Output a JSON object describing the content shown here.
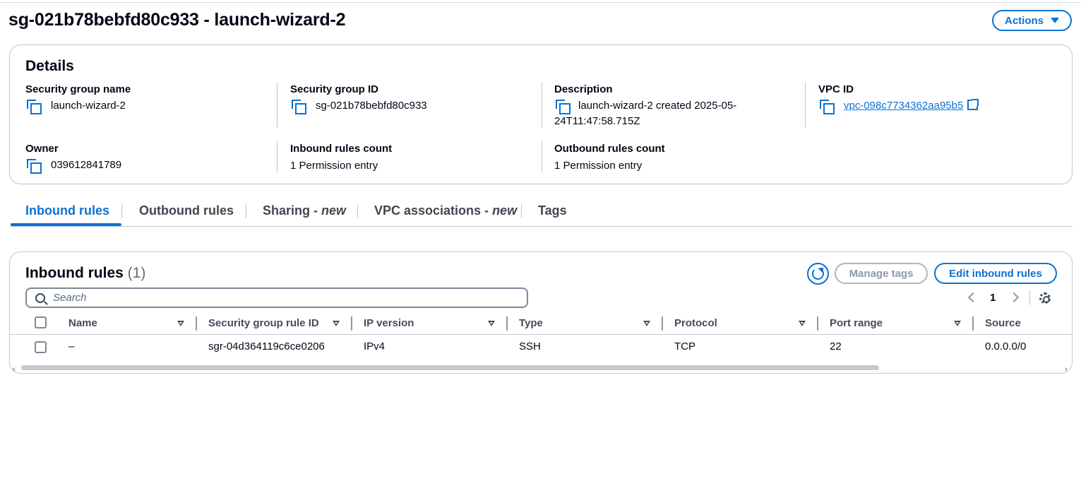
{
  "page": {
    "title": "sg-021b78bebfd80c933 - launch-wizard-2",
    "actions_label": "Actions"
  },
  "details": {
    "heading": "Details",
    "security_group_name": {
      "label": "Security group name",
      "value": "launch-wizard-2"
    },
    "security_group_id": {
      "label": "Security group ID",
      "value": "sg-021b78bebfd80c933"
    },
    "description": {
      "label": "Description",
      "value": "launch-wizard-2 created 2025-05-24T11:47:58.715Z"
    },
    "vpc_id": {
      "label": "VPC ID",
      "value": "vpc-098c7734362aa95b5"
    },
    "owner": {
      "label": "Owner",
      "value": "039612841789"
    },
    "inbound_rules_count": {
      "label": "Inbound rules count",
      "value": "1 Permission entry"
    },
    "outbound_rules_count": {
      "label": "Outbound rules count",
      "value": "1 Permission entry"
    }
  },
  "tabs": {
    "inbound": "Inbound rules",
    "outbound": "Outbound rules",
    "sharing": "Sharing - ",
    "sharing_new": "new",
    "vpc_assoc": "VPC associations - ",
    "vpc_assoc_new": "new",
    "tags": "Tags"
  },
  "inbound_panel": {
    "heading": "Inbound rules",
    "count": "(1)",
    "manage_tags_label": "Manage tags",
    "edit_label": "Edit inbound rules",
    "search_placeholder": "Search",
    "page_number": "1",
    "columns": {
      "name": "Name",
      "rule_id": "Security group rule ID",
      "ip_version": "IP version",
      "type": "Type",
      "protocol": "Protocol",
      "port_range": "Port range",
      "source": "Source"
    },
    "rows": [
      {
        "name": "–",
        "rule_id": "sgr-04d364119c6ce0206",
        "ip_version": "IPv4",
        "type": "SSH",
        "protocol": "TCP",
        "port_range": "22",
        "source": "0.0.0.0/0"
      }
    ]
  },
  "icons": {
    "copy": "copy-icon",
    "external_link": "external-link-icon",
    "refresh": "refresh-icon",
    "search": "search-icon",
    "settings": "gear-icon"
  },
  "colors": {
    "accent": "#0972d3",
    "text": "#000716",
    "border": "#c6c6cd",
    "disabled": "#8d99a8"
  }
}
